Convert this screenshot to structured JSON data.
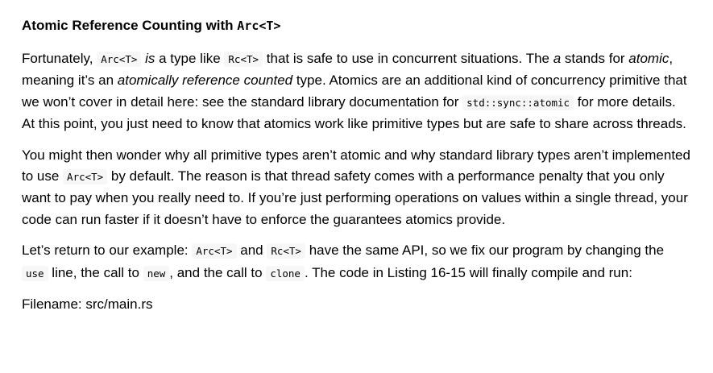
{
  "heading": {
    "text": "Atomic Reference Counting with ",
    "code": "Arc<T>"
  },
  "paragraph1": {
    "t1": "Fortunately, ",
    "c1": "Arc<T>",
    "t2": " ",
    "em1": "is",
    "t3": " a type like ",
    "c2": "Rc<T>",
    "t4": " that is safe to use in concurrent situations. The ",
    "em2": "a",
    "t5": " stands for ",
    "em3": "atomic",
    "t6": ", meaning it’s an ",
    "em4": "atomically reference counted",
    "t7": " type. Atomics are an additional kind of concurrency primitive that we won’t cover in detail here: see the standard library documentation for ",
    "c3": "std::sync::atomic",
    "t8": " for more details. At this point, you just need to know that atomics work like primitive types but are safe to share across threads."
  },
  "paragraph2": {
    "t1": "You might then wonder why all primitive types aren’t atomic and why standard library types aren’t implemented to use ",
    "c1": "Arc<T>",
    "t2": " by default. The reason is that thread safety comes with a performance penalty that you only want to pay when you really need to. If you’re just performing operations on values within a single thread, your code can run faster if it doesn’t have to enforce the guarantees atomics provide."
  },
  "paragraph3": {
    "t1": "Let’s return to our example: ",
    "c1": "Arc<T>",
    "t2": " and ",
    "c2": "Rc<T>",
    "t3": " have the same API, so we fix our program by changing the ",
    "c3": "use",
    "t4": " line, the call to ",
    "c4": "new",
    "t5": ", and the call to ",
    "c5": "clone",
    "t6": ". The code in Listing 16-15 will finally compile and run:"
  },
  "paragraph4": {
    "t1": "Filename: src/main.rs"
  }
}
